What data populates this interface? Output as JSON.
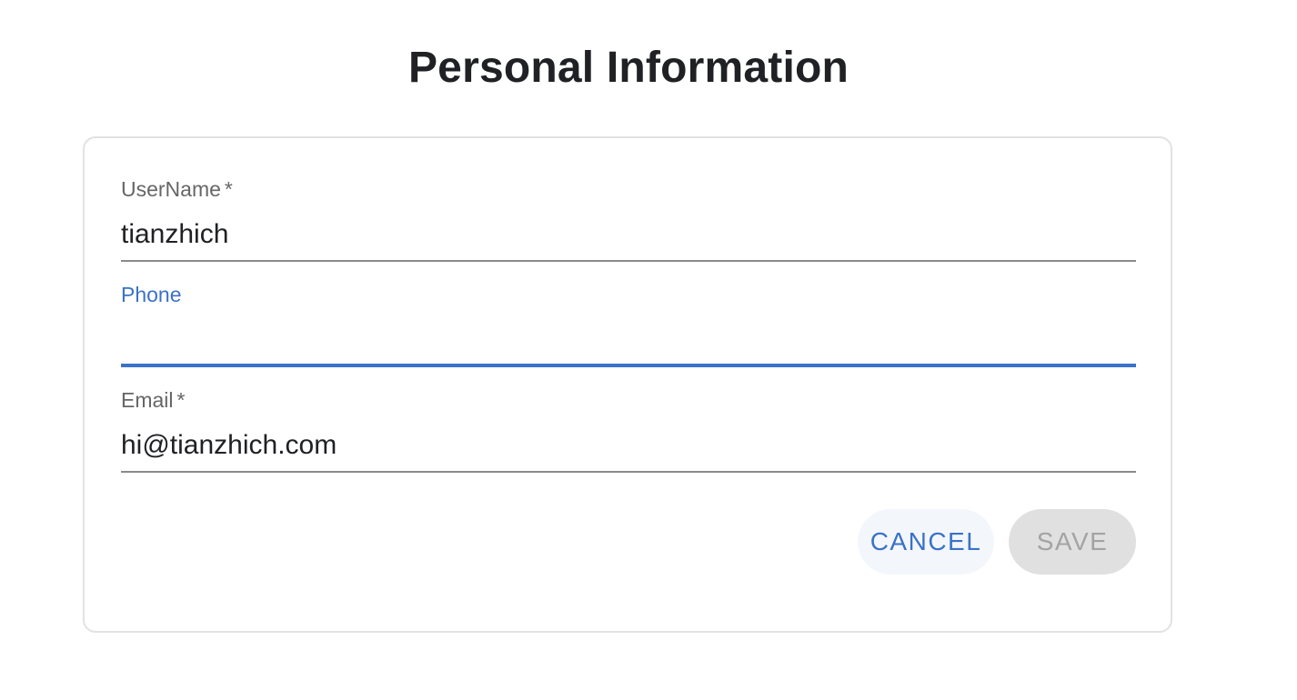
{
  "page": {
    "title": "Personal Information"
  },
  "form": {
    "username": {
      "label": "UserName",
      "required_mark": "*",
      "value": "tianzhich"
    },
    "phone": {
      "label": "Phone",
      "value": "",
      "state": "focused"
    },
    "email": {
      "label": "Email",
      "required_mark": "*",
      "value": "hi@tianzhich.com"
    },
    "actions": {
      "cancel_label": "CANCEL",
      "save_label": "SAVE",
      "save_disabled": true
    }
  },
  "colors": {
    "accent": "#3a72c8",
    "title_text": "#202124",
    "label_text": "#666666",
    "disabled_bg": "#e0e0e0",
    "disabled_text": "#a3a3a3"
  }
}
